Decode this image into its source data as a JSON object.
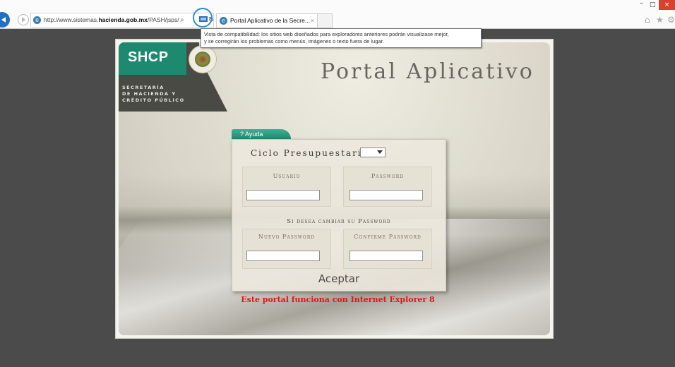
{
  "browser": {
    "address_prefix": "http://www.sistemas.",
    "address_host": "hacienda.gob.mx",
    "address_path": "/PASH/jsps/",
    "tab_title": "Portal Aplicativo de la Secre...",
    "tab_close": "×",
    "win_minimize": "–",
    "win_maximize": "□",
    "win_close": "×",
    "tooltip_line1": "Vista de compatibilidad: los sitios web diseñados para exploradores anteriores podrán visualizase mejor,",
    "tooltip_line2": "y se corregirán los problemas como menús, imágenes o texto fuera de lugar."
  },
  "icons": {
    "ie": "e",
    "search": "⌕",
    "refresh": "↻",
    "home": "⌂",
    "star": "★",
    "gear": "⚙"
  },
  "brand": {
    "abbr": "SHCP",
    "line1": "SECRETARÍA",
    "line2": "DE HACIENDA Y",
    "line3": "CRÉDITO PÚBLICO",
    "green": "#1d8a6f",
    "dark": "#4a4a45"
  },
  "page": {
    "title": "Portal Aplicativo",
    "help_label": "? Ayuda"
  },
  "form": {
    "ciclo_label": "Ciclo Presupuestario:",
    "ciclo_value": "",
    "usuario_label": "Usuario",
    "password_label": "Password",
    "change_label": "Si desea cambiar su Password",
    "nuevo_label": "Nuevo Password",
    "confirme_label": "Confirme Password",
    "accept_label": "Aceptar"
  },
  "notice": {
    "text": "Este portal funciona con Internet Explorer 8",
    "color": "#e2141c"
  }
}
